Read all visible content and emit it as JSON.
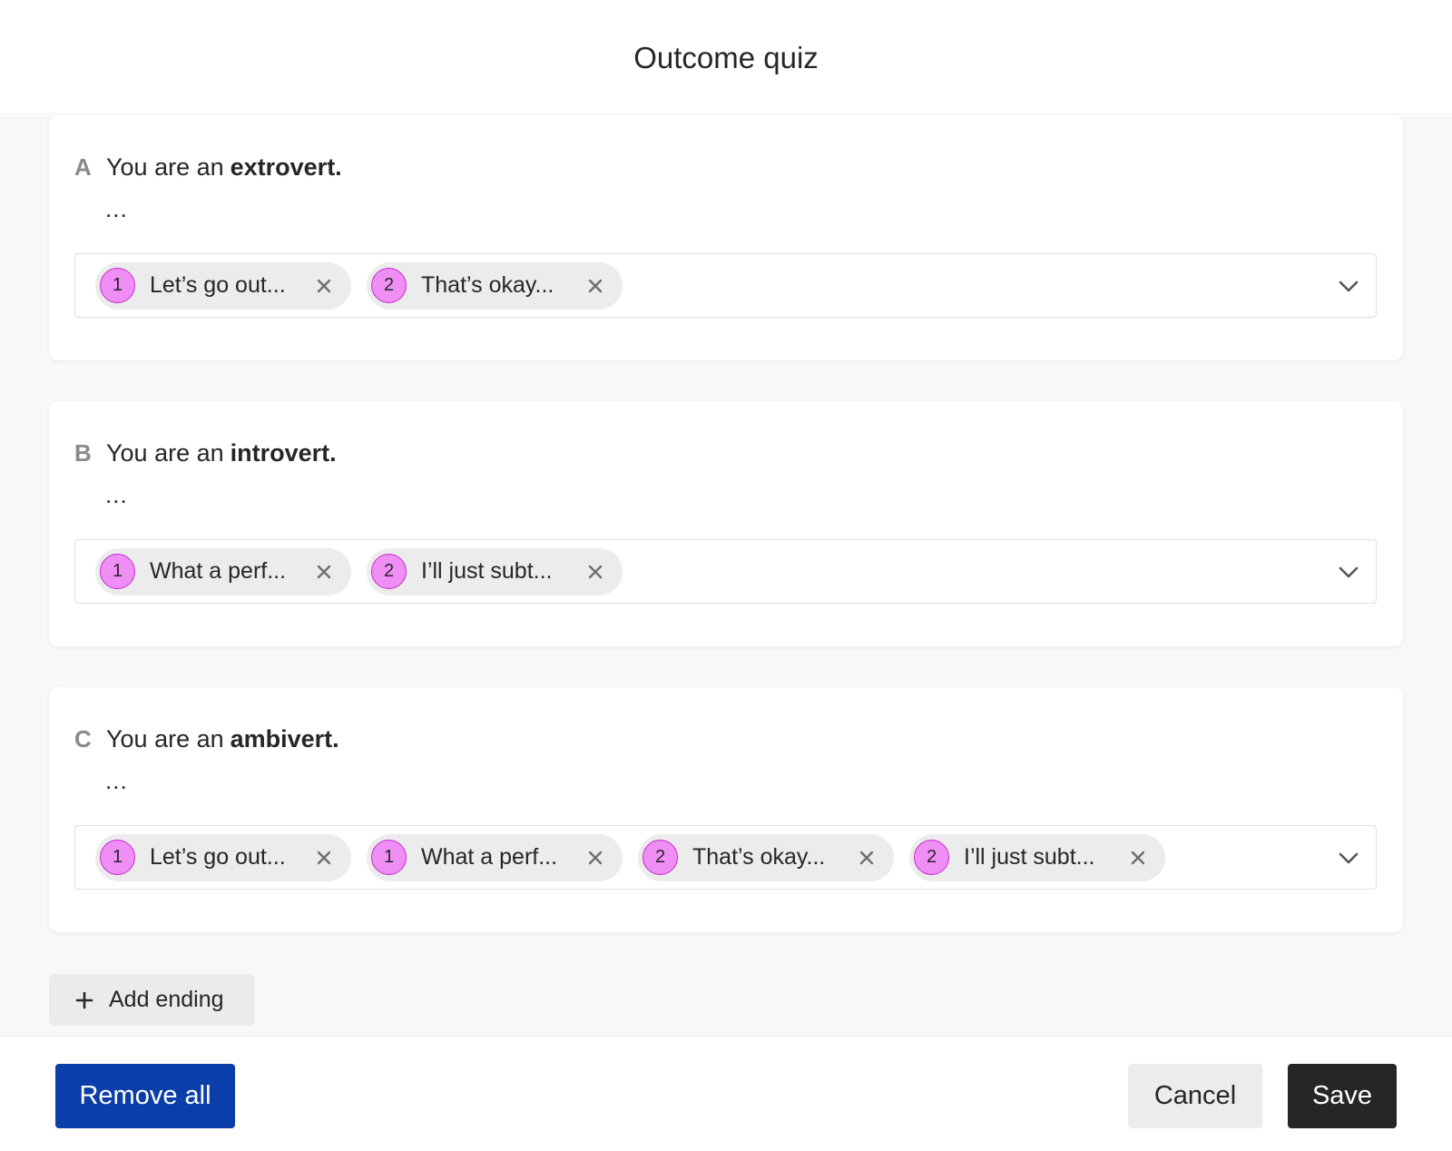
{
  "header": {
    "title": "Outcome quiz"
  },
  "endings": [
    {
      "letter": "A",
      "prefix": "You are an",
      "strong": "extrovert.",
      "description": "...",
      "chips": [
        {
          "num": "1",
          "label": "Let’s go out..."
        },
        {
          "num": "2",
          "label": "That’s okay..."
        }
      ]
    },
    {
      "letter": "B",
      "prefix": "You are an",
      "strong": "introvert.",
      "description": "...",
      "chips": [
        {
          "num": "1",
          "label": "What a perf..."
        },
        {
          "num": "2",
          "label": "I’ll just subt..."
        }
      ]
    },
    {
      "letter": "C",
      "prefix": "You are an",
      "strong": "ambivert.",
      "description": "...",
      "chips": [
        {
          "num": "1",
          "label": "Let’s go out..."
        },
        {
          "num": "1",
          "label": "What a perf..."
        },
        {
          "num": "2",
          "label": "That’s okay..."
        },
        {
          "num": "2",
          "label": "I’ll just subt..."
        }
      ]
    }
  ],
  "add_ending_label": "Add ending",
  "footer": {
    "remove_all_label": "Remove all",
    "cancel_label": "Cancel",
    "save_label": "Save"
  },
  "colors": {
    "badge_fill": "#ef8ef5",
    "badge_border": "#c42ec9",
    "primary_blue": "#0b3ea8",
    "save_dark": "#262627"
  },
  "icons": {
    "chip_remove": "close-icon",
    "dropdown": "chevron-down-icon",
    "add": "plus-icon"
  }
}
